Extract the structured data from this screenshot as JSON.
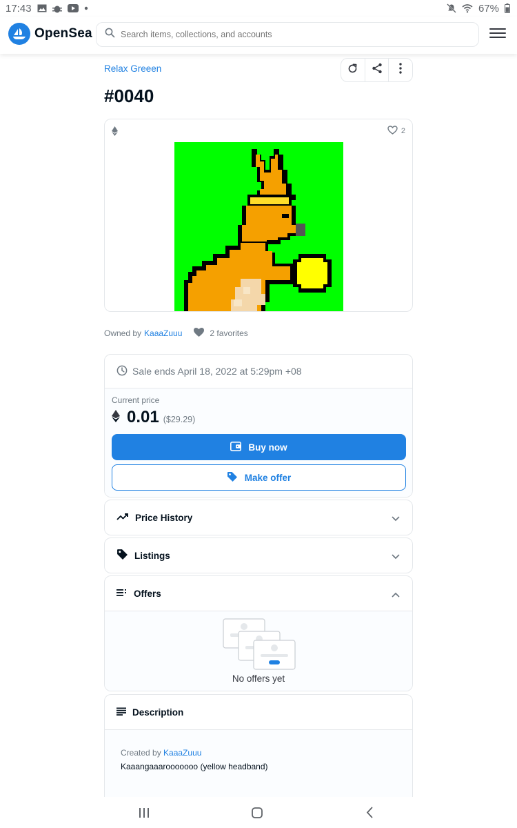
{
  "status_bar": {
    "time": "17:43",
    "battery": "67%"
  },
  "header": {
    "brand": "OpenSea",
    "search_placeholder": "Search items, collections, and accounts"
  },
  "item": {
    "collection": "Relax Greeen",
    "title": "#0040",
    "media_favorites": "2",
    "owned_by_label": "Owned by",
    "owner": "KaaaZuuu",
    "favorites": "2 favorites"
  },
  "sale": {
    "ends_text": "Sale ends April 18, 2022 at 5:29pm +08",
    "current_price_label": "Current price",
    "price": "0.01",
    "price_usd": "($29.29)",
    "buy_label": "Buy now",
    "offer_label": "Make offer"
  },
  "panels": {
    "price_history": "Price History",
    "listings": "Listings",
    "offers": "Offers",
    "no_offers": "No offers yet",
    "description": "Description"
  },
  "description": {
    "created_by_label": "Created by",
    "creator": "KaaaZuuu",
    "text": "Kaaangaaarooooooo (yellow headband)"
  },
  "colors": {
    "accent": "#2081e2",
    "nft_background": "#00ff00",
    "kangaroo": "#f5a000",
    "ball": "#ffff00",
    "headband": "#ffdd2a"
  },
  "icons": [
    "image-icon",
    "bug-icon",
    "youtube-icon",
    "mute-icon",
    "wifi-icon",
    "opensea-logo-icon",
    "search-icon",
    "hamburger-menu-icon",
    "refresh-icon",
    "share-icon",
    "more-vertical-icon",
    "ethereum-icon",
    "heart-icon",
    "clock-icon",
    "wallet-icon",
    "tag-icon",
    "trend-icon",
    "chevron-down-icon",
    "chevron-up-icon",
    "list-icon",
    "description-lines-icon",
    "recent-apps-icon",
    "home-icon",
    "back-icon"
  ]
}
